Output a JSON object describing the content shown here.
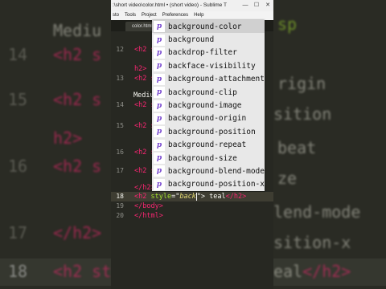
{
  "window": {
    "title": "color.html • (short video) - Sublime T...",
    "title_full": ":\\short video\\color.html • (short video) - Sublime T",
    "minimize": "—",
    "maximize": "☐",
    "close": "✕"
  },
  "menu": [
    "sto",
    "Tools",
    "Project",
    "Preferences",
    "Help"
  ],
  "tab": {
    "label": "color.html"
  },
  "gutter": [
    "12",
    "13",
    "14",
    "15",
    "16",
    "17",
    "18",
    "19",
    "20"
  ],
  "code_lines": {
    "l12": "<h2 s",
    "l12b": "h2>",
    "l13": "<h2 s",
    "l13b": "Mediu",
    "l14": "<h2 s",
    "l15": "<h2 s",
    "l16": "<h2 s",
    "l17b": "</h2>",
    "l18a": "<h2 ",
    "l18b": "style",
    "l18c": "=\"",
    "l18d": "back",
    "l18e": "\"> teal",
    "l18f": "</h2>",
    "l19": "</body>",
    "l20": "</html>"
  },
  "autocomplete": [
    "background-color",
    "background",
    "backdrop-filter",
    "backface-visibility",
    "background-attachment",
    "background-clip",
    "background-image",
    "background-origin",
    "background-position",
    "background-repeat",
    "background-size",
    "background-blend-mode",
    "background-position-x"
  ],
  "autocomplete_kind": "p",
  "background": {
    "lines": [
      "Mediu",
      "14  <h2 s",
      "        sp",
      "15  <h2 s",
      "        rigin",
      "h2>",
      "        sition",
      "16  <h2 s",
      "        beat",
      "<h2 s",
      "        ze",
      "17  </h2>",
      "        lend-mode",
      "        sition-x",
      "18  <h2 st",
      "        eal</h2>"
    ]
  },
  "colors": {
    "editor_bg": "#272822",
    "tag": "#f92672",
    "attr": "#a6e22e",
    "string": "#e6db74"
  }
}
